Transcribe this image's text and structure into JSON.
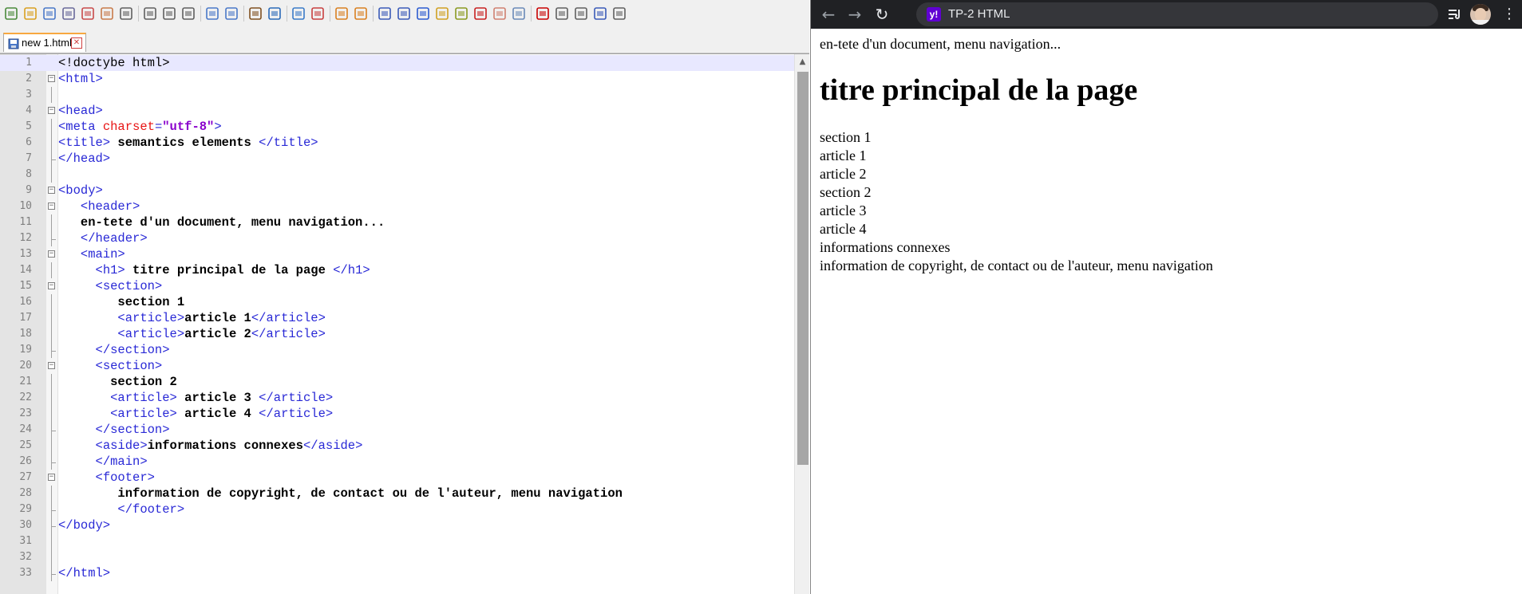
{
  "editor": {
    "toolbar_icons": [
      "new-file-icon",
      "open-file-icon",
      "save-icon",
      "save-all-icon",
      "close-icon",
      "close-all-icon",
      "print-icon",
      "cut-icon",
      "copy-icon",
      "paste-icon",
      "undo-icon",
      "redo-icon",
      "find-icon",
      "replace-icon",
      "zoom-in-icon",
      "zoom-out-icon",
      "sync-vertical-icon",
      "sync-horizontal-icon",
      "word-wrap-icon",
      "show-all-chars-icon",
      "indent-guide-icon",
      "udl-icon",
      "doc-map-icon",
      "function-list-icon",
      "folder-workspace-icon",
      "monitoring-icon",
      "record-macro-icon",
      "stop-record-icon",
      "play-macro-icon",
      "run-macro-multiple-icon",
      "save-macro-icon"
    ],
    "tab": {
      "label": "new 1.html",
      "close_glyph": "✕"
    },
    "lines": [
      {
        "n": "1",
        "indent": "",
        "parts": [
          {
            "t": "<!doctybe html>",
            "c": "doc"
          }
        ]
      },
      {
        "n": "2",
        "indent": "",
        "parts": [
          {
            "t": "<html>",
            "c": "tag"
          }
        ]
      },
      {
        "n": "3",
        "indent": "",
        "parts": []
      },
      {
        "n": "4",
        "indent": "",
        "parts": [
          {
            "t": "<head>",
            "c": "tag"
          }
        ]
      },
      {
        "n": "5",
        "indent": "",
        "parts": [
          {
            "t": "<meta ",
            "c": "tag"
          },
          {
            "t": "charset",
            "c": "attr"
          },
          {
            "t": "=",
            "c": "tag"
          },
          {
            "t": "\"utf-8\"",
            "c": "str"
          },
          {
            "t": ">",
            "c": "tag"
          }
        ]
      },
      {
        "n": "6",
        "indent": "",
        "parts": [
          {
            "t": "<title>",
            "c": "tag"
          },
          {
            "t": " semantics elements ",
            "c": "text"
          },
          {
            "t": "</title>",
            "c": "tag"
          }
        ]
      },
      {
        "n": "7",
        "indent": "",
        "parts": [
          {
            "t": "</head>",
            "c": "tag"
          }
        ]
      },
      {
        "n": "8",
        "indent": "",
        "parts": []
      },
      {
        "n": "9",
        "indent": "",
        "parts": [
          {
            "t": "<body>",
            "c": "tag"
          }
        ]
      },
      {
        "n": "10",
        "indent": "   ",
        "parts": [
          {
            "t": "<header>",
            "c": "tag"
          }
        ]
      },
      {
        "n": "11",
        "indent": "   ",
        "parts": [
          {
            "t": "en-tete d'un document, menu navigation...",
            "c": "text"
          }
        ]
      },
      {
        "n": "12",
        "indent": "   ",
        "parts": [
          {
            "t": "</header>",
            "c": "tag"
          }
        ]
      },
      {
        "n": "13",
        "indent": "   ",
        "parts": [
          {
            "t": "<main>",
            "c": "tag"
          }
        ]
      },
      {
        "n": "14",
        "indent": "     ",
        "parts": [
          {
            "t": "<h1>",
            "c": "tag"
          },
          {
            "t": " titre principal de la page ",
            "c": "text"
          },
          {
            "t": "</h1>",
            "c": "tag"
          }
        ]
      },
      {
        "n": "15",
        "indent": "     ",
        "parts": [
          {
            "t": "<section>",
            "c": "tag"
          }
        ]
      },
      {
        "n": "16",
        "indent": "        ",
        "parts": [
          {
            "t": "section 1",
            "c": "text"
          }
        ]
      },
      {
        "n": "17",
        "indent": "        ",
        "parts": [
          {
            "t": "<article>",
            "c": "tag"
          },
          {
            "t": "article 1",
            "c": "text"
          },
          {
            "t": "</article>",
            "c": "tag"
          }
        ]
      },
      {
        "n": "18",
        "indent": "        ",
        "parts": [
          {
            "t": "<article>",
            "c": "tag"
          },
          {
            "t": "article 2",
            "c": "text"
          },
          {
            "t": "</article>",
            "c": "tag"
          }
        ]
      },
      {
        "n": "19",
        "indent": "     ",
        "parts": [
          {
            "t": "</section>",
            "c": "tag"
          }
        ]
      },
      {
        "n": "20",
        "indent": "     ",
        "parts": [
          {
            "t": "<section>",
            "c": "tag"
          }
        ]
      },
      {
        "n": "21",
        "indent": "       ",
        "parts": [
          {
            "t": "section 2",
            "c": "text"
          }
        ]
      },
      {
        "n": "22",
        "indent": "       ",
        "parts": [
          {
            "t": "<article>",
            "c": "tag"
          },
          {
            "t": " article 3 ",
            "c": "text"
          },
          {
            "t": "</article>",
            "c": "tag"
          }
        ]
      },
      {
        "n": "23",
        "indent": "       ",
        "parts": [
          {
            "t": "<article>",
            "c": "tag"
          },
          {
            "t": " article 4 ",
            "c": "text"
          },
          {
            "t": "</article>",
            "c": "tag"
          }
        ]
      },
      {
        "n": "24",
        "indent": "     ",
        "parts": [
          {
            "t": "</section>",
            "c": "tag"
          }
        ]
      },
      {
        "n": "25",
        "indent": "     ",
        "parts": [
          {
            "t": "<aside>",
            "c": "tag"
          },
          {
            "t": "informations connexes",
            "c": "text"
          },
          {
            "t": "</aside>",
            "c": "tag"
          }
        ]
      },
      {
        "n": "26",
        "indent": "     ",
        "parts": [
          {
            "t": "</main>",
            "c": "tag"
          }
        ]
      },
      {
        "n": "27",
        "indent": "     ",
        "parts": [
          {
            "t": "<footer>",
            "c": "tag"
          }
        ]
      },
      {
        "n": "28",
        "indent": "        ",
        "parts": [
          {
            "t": "information de copyright, de contact ou de l'auteur, menu navigation",
            "c": "text"
          }
        ]
      },
      {
        "n": "29",
        "indent": "        ",
        "parts": [
          {
            "t": "</footer>",
            "c": "tag"
          }
        ]
      },
      {
        "n": "30",
        "indent": "",
        "parts": [
          {
            "t": "</body>",
            "c": "tag"
          }
        ]
      },
      {
        "n": "31",
        "indent": "",
        "parts": []
      },
      {
        "n": "32",
        "indent": "",
        "parts": []
      },
      {
        "n": "33",
        "indent": "",
        "parts": [
          {
            "t": "</html>",
            "c": "tag"
          }
        ]
      }
    ]
  },
  "browser": {
    "nav": {
      "back": "←",
      "forward": "→",
      "reload": "↻"
    },
    "site_icon_text": "y!",
    "page_title": "TP-2 HTML",
    "menu_glyph": "⋮",
    "page": {
      "header_text": "en-tete d'un document, menu navigation...",
      "h1": "titre principal de la page",
      "section1": "section 1",
      "article1": "article 1",
      "article2": "article 2",
      "section2": "section 2",
      "article3": "article 3",
      "article4": "article 4",
      "aside": "informations connexes",
      "footer": "information de copyright, de contact ou de l'auteur, menu navigation"
    }
  },
  "colors": {
    "tag": "#2929d6",
    "attr": "#e81414",
    "string": "#8a00cc",
    "current_line": "#e8e8ff",
    "browser_bar": "#202124"
  }
}
